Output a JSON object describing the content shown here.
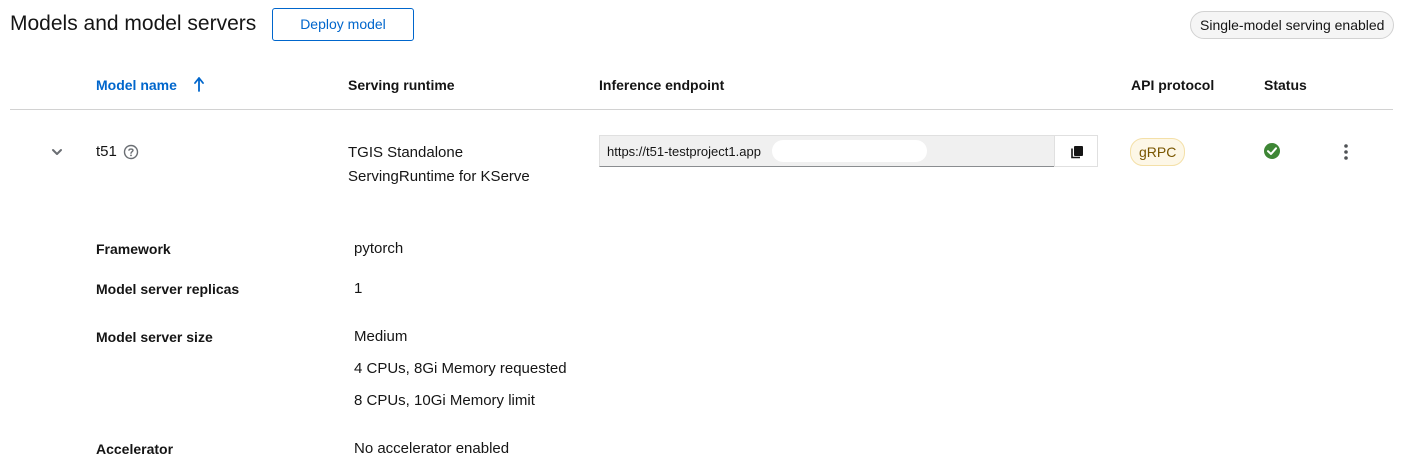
{
  "header": {
    "title": "Models and model servers",
    "deploy_label": "Deploy model",
    "serving_badge": "Single-model serving enabled"
  },
  "table": {
    "columns": {
      "model_name": "Model name",
      "serving_runtime": "Serving runtime",
      "inference_endpoint": "Inference endpoint",
      "api_protocol": "API protocol",
      "status": "Status"
    },
    "sort_icon": "arrow-up-icon",
    "row": {
      "expand_icon": "chevron-down-icon",
      "model_name": "t51",
      "help_icon": "question-circle-icon",
      "runtime_line1": "TGIS Standalone",
      "runtime_line2": "ServingRuntime for KServe",
      "endpoint": "https://t51-testproject1.app",
      "copy_icon": "copy-icon",
      "api_protocol": "gRPC",
      "status_icon": "check-circle-icon",
      "status_color": "#3e8635",
      "kebab_icon": "kebab-icon"
    }
  },
  "details": {
    "framework": {
      "label": "Framework",
      "value": "pytorch"
    },
    "replicas": {
      "label": "Model server replicas",
      "value": "1"
    },
    "size": {
      "label": "Model server size",
      "value": "Medium",
      "requested": "4 CPUs, 8Gi Memory requested",
      "limit": "8 CPUs, 10Gi Memory limit"
    },
    "accelerator": {
      "label": "Accelerator",
      "value": "No accelerator enabled"
    }
  },
  "colors": {
    "link": "#0066cc",
    "divider": "#d2d2d2"
  }
}
